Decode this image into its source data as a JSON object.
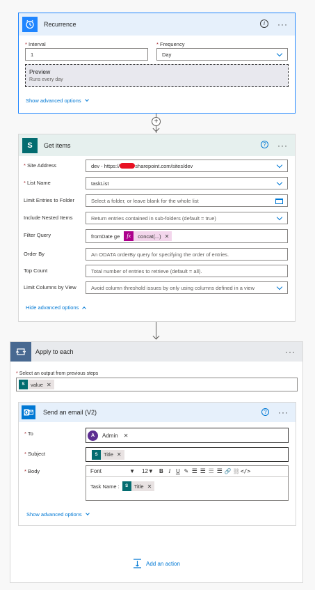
{
  "recurrence": {
    "title": "Recurrence",
    "more": "···",
    "info": "i",
    "interval_label": "Interval",
    "interval_value": "1",
    "frequency_label": "Frequency",
    "frequency_value": "Day",
    "preview_title": "Preview",
    "preview_text": "Runs every day",
    "show_advanced": "Show advanced options"
  },
  "get_items": {
    "title": "Get items",
    "more": "···",
    "help": "?",
    "icon_text": "S",
    "site_label": "Site Address",
    "site_prefix": "dev - https://",
    "site_suffix": "sharepoint.com/sites/dev",
    "list_label": "List Name",
    "list_value": "taskList",
    "limit_folder_label": "Limit Entries to Folder",
    "limit_folder_placeholder": "Select a folder, or leave blank for the whole list",
    "nested_label": "Include Nested Items",
    "nested_placeholder": "Return entries contained in sub-folders (default = true)",
    "filter_label": "Filter Query",
    "filter_text": "fromDate ge",
    "filter_token": "concat(...)",
    "filter_fx": "fx",
    "order_label": "Order By",
    "order_placeholder": "An ODATA orderBy query for specifying the order of entries.",
    "top_label": "Top Count",
    "top_placeholder": "Total number of entries to retrieve (default = all).",
    "columns_label": "Limit Columns by View",
    "columns_placeholder": "Avoid column threshold issues by only using columns defined in a view",
    "hide_advanced": "Hide advanced options"
  },
  "apply_each": {
    "title": "Apply to each",
    "more": "···",
    "output_label": "Select an output from previous steps",
    "output_token": "value"
  },
  "email": {
    "title": "Send an email (V2)",
    "more": "···",
    "help": "?",
    "to_label": "To",
    "to_token": "Admin",
    "to_avatar": "A",
    "subject_label": "Subject",
    "subject_token": "Title",
    "body_label": "Body",
    "font_value": "Font",
    "size_value": "12",
    "body_text": "Task Name :",
    "body_token": "Title",
    "show_advanced": "Show advanced options",
    "add_action": "Add an action"
  },
  "colors": {
    "recurrence_header": "#e6f0fb",
    "recurrence_accent": "#1f85ff",
    "sharepoint": "#036c70",
    "apply_header": "#e8eaed",
    "apply_icon_bg": "#486991",
    "outlook": "#0078d4",
    "link": "#0078d4",
    "fx": "#ad008c",
    "redaction": "#e81123"
  }
}
